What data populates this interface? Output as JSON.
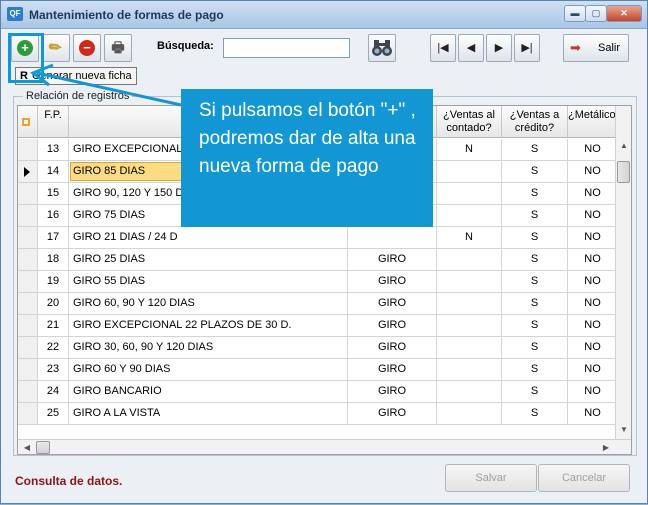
{
  "window": {
    "app_icon": "QF",
    "title": "Mantenimiento de formas de pago",
    "minimize": "▬",
    "maximize": "▢",
    "close": "✕"
  },
  "toolbar": {
    "add_icon": "+",
    "edit_icon": "✎",
    "delete_icon": "−",
    "print_icon": "🖶",
    "search_label": "Búsqueda:",
    "search_value": "",
    "search_icon": "binoculars",
    "nav_first": "|◀",
    "nav_prev": "◀",
    "nav_next": "▶",
    "nav_last": "▶|",
    "exit_icon": "➡",
    "exit_label": "Salir"
  },
  "tooltip": {
    "key": "R",
    "text": "Generar nueva ficha"
  },
  "group": {
    "caption": "Relación de registros"
  },
  "grid": {
    "columns": [
      "F.P.",
      "",
      "",
      "¿Ventas al contado?",
      "¿Ventas a crédito?",
      "¿Metálico?"
    ],
    "rows": [
      {
        "fp": "13",
        "desc": "GIRO EXCEPCIONAL 1",
        "tipo": "",
        "contado": "N",
        "credito": "S",
        "metalico": "NO"
      },
      {
        "fp": "14",
        "desc": "GIRO 85 DIAS",
        "tipo": "",
        "contado": "",
        "credito": "S",
        "metalico": "NO"
      },
      {
        "fp": "15",
        "desc": "GIRO 90, 120 Y 150 D",
        "tipo": "",
        "contado": "",
        "credito": "S",
        "metalico": "NO"
      },
      {
        "fp": "16",
        "desc": "GIRO 75 DIAS",
        "tipo": "",
        "contado": "",
        "credito": "S",
        "metalico": "NO"
      },
      {
        "fp": "17",
        "desc": "GIRO 21 DIAS / 24 D",
        "tipo": "",
        "contado": "N",
        "credito": "S",
        "metalico": "NO"
      },
      {
        "fp": "18",
        "desc": "GIRO 25 DIAS",
        "tipo": "GIRO",
        "contado": "",
        "credito": "S",
        "metalico": "NO"
      },
      {
        "fp": "19",
        "desc": "GIRO 55 DIAS",
        "tipo": "GIRO",
        "contado": "",
        "credito": "S",
        "metalico": "NO"
      },
      {
        "fp": "20",
        "desc": "GIRO 60, 90 Y 120 DIAS",
        "tipo": "GIRO",
        "contado": "",
        "credito": "S",
        "metalico": "NO"
      },
      {
        "fp": "21",
        "desc": "GIRO EXCEPCIONAL 22 PLAZOS DE 30 D.",
        "tipo": "GIRO",
        "contado": "",
        "credito": "S",
        "metalico": "NO"
      },
      {
        "fp": "22",
        "desc": "GIRO 30, 60, 90 Y 120 DIAS",
        "tipo": "GIRO",
        "contado": "",
        "credito": "S",
        "metalico": "NO"
      },
      {
        "fp": "23",
        "desc": "GIRO 60 Y 90 DIAS",
        "tipo": "GIRO",
        "contado": "",
        "credito": "S",
        "metalico": "NO"
      },
      {
        "fp": "24",
        "desc": "GIRO BANCARIO",
        "tipo": "GIRO",
        "contado": "",
        "credito": "S",
        "metalico": "NO"
      },
      {
        "fp": "25",
        "desc": "GIRO A LA VISTA",
        "tipo": "GIRO",
        "contado": "",
        "credito": "S",
        "metalico": "NO"
      }
    ],
    "selected_row": 1
  },
  "callout": {
    "text": "Si pulsamos el botón \"+\" , podremos dar de alta una nueva forma de pago",
    "color": "#1396d4"
  },
  "status": {
    "text": "Consulta de datos.",
    "save_label": "Salvar",
    "cancel_label": "Cancelar"
  }
}
